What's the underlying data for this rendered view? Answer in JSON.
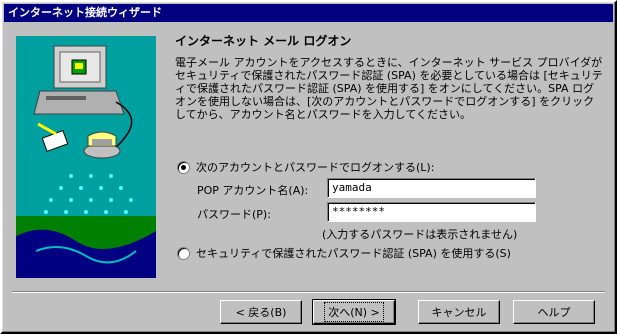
{
  "window": {
    "title": "インターネット接続ウィザード"
  },
  "main": {
    "heading": "インターネット メール ログオン",
    "description": "電子メール アカウントをアクセスするときに、インターネット サービス プロバイダがセキュリティで保護されたパスワード認証 (SPA) を必要としている場合は [セキュリティで保護されたパスワード認証 (SPA) を使用する] をオンにしてください。SPA ログオンを使用しない場合は、[次のアカウントとパスワードでログオンする] をクリックしてから、アカウント名とパスワードを入力してください。",
    "radio_account_label": "次のアカウントとパスワードでログオンする(L):",
    "radio_account_checked": true,
    "pop_account_label": "POP アカウント名(A):",
    "pop_account_value": "yamada",
    "password_label": "パスワード(P):",
    "password_value": "********",
    "password_note": "(入力するパスワードは表示されません)",
    "radio_spa_label": "セキュリティで保護されたパスワード認証 (SPA) を使用する(S)",
    "radio_spa_checked": false
  },
  "buttons": {
    "back": "< 戻る(B)",
    "next": "次へ(N) >",
    "cancel": "キャンセル",
    "help": "ヘルプ"
  }
}
